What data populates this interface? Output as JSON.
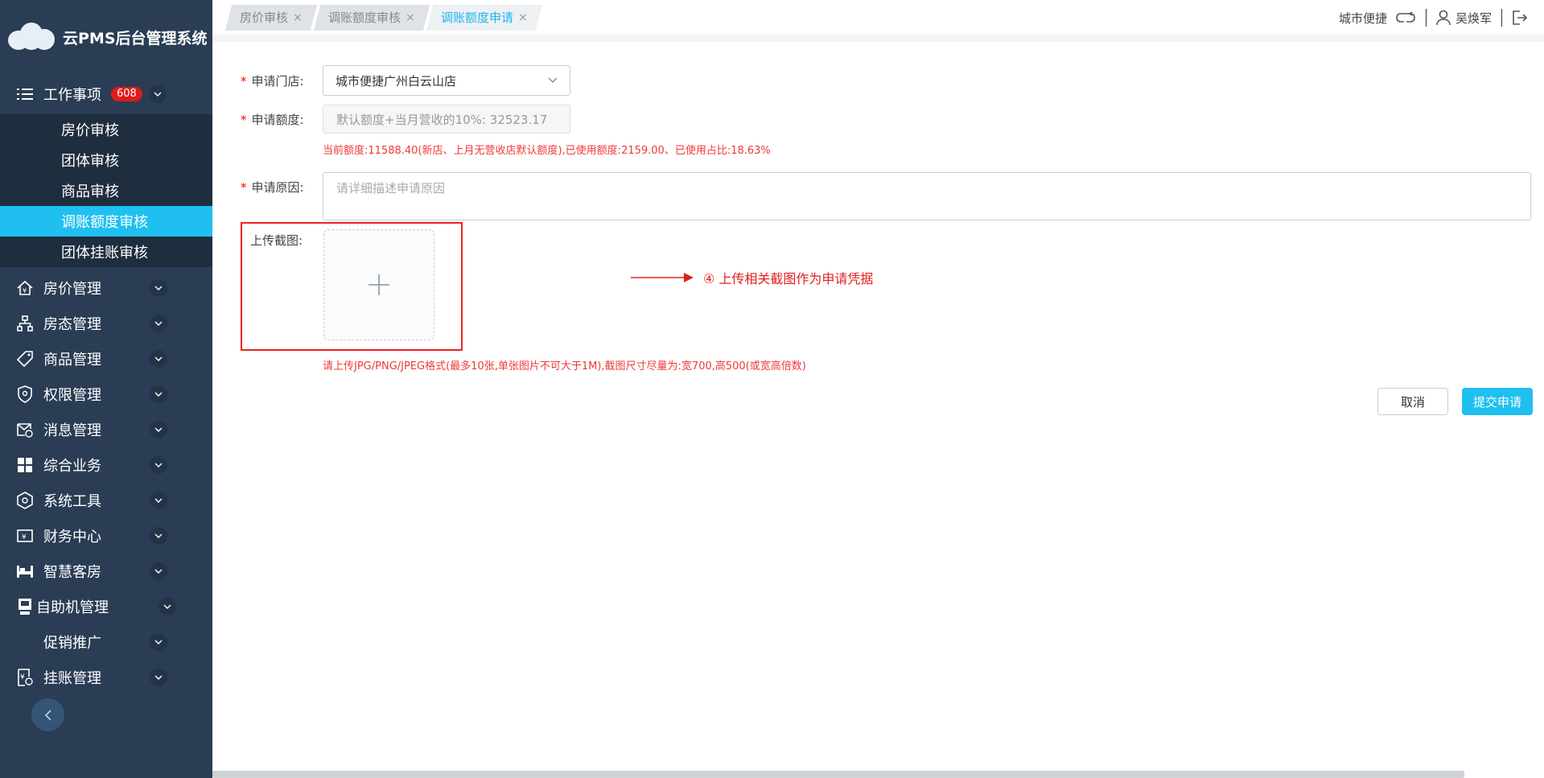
{
  "app": {
    "title": "云PMS后台管理系统"
  },
  "sidebar": {
    "work": {
      "label": "工作事项",
      "badge": "608"
    },
    "work_items": [
      "房价审核",
      "团体审核",
      "商品审核",
      "调账额度审核",
      "团体挂账审核"
    ],
    "active_item": "调账额度审核",
    "menus": [
      {
        "label": "房价管理",
        "icon": "house-price-icon"
      },
      {
        "label": "房态管理",
        "icon": "room-status-icon"
      },
      {
        "label": "商品管理",
        "icon": "tag-icon"
      },
      {
        "label": "权限管理",
        "icon": "shield-icon"
      },
      {
        "label": "消息管理",
        "icon": "message-icon"
      },
      {
        "label": "综合业务",
        "icon": "grid-icon"
      },
      {
        "label": "系统工具",
        "icon": "hexagon-icon"
      },
      {
        "label": "财务中心",
        "icon": "finance-icon"
      },
      {
        "label": "智慧客房",
        "icon": "bed-icon"
      },
      {
        "label": "自助机管理",
        "icon": "kiosk-icon"
      },
      {
        "label": "促销推广",
        "icon": ""
      },
      {
        "label": "挂账管理",
        "icon": "ledger-icon"
      }
    ]
  },
  "tabs": [
    {
      "label": "房价审核",
      "active": false
    },
    {
      "label": "调账额度审核",
      "active": false
    },
    {
      "label": "调账额度申请",
      "active": true
    }
  ],
  "header": {
    "hotel_brand": "城市便捷",
    "user_name": "吴焕军"
  },
  "form": {
    "store": {
      "label": "申请门店:",
      "value": "城市便捷广州白云山店"
    },
    "amount": {
      "label": "申请额度:",
      "placeholder": "默认额度+当月营收的10%:  32523.17"
    },
    "amount_hint": "当前额度:11588.40(新店、上月无营收店默认额度),已使用额度:2159.00、已使用占比:18.63%",
    "reason": {
      "label": "申请原因:",
      "placeholder": "请详细描述申请原因"
    },
    "upload": {
      "label": "上传截图:"
    },
    "upload_hint": "请上传JPG/PNG/JPEG格式(最多10张,单张图片不可大于1M),截图尺寸尽量为:宽700,高500(或宽高倍数)",
    "annotation": "④ 上传相关截图作为申请凭据",
    "cancel": "取消",
    "submit": "提交申请"
  },
  "colors": {
    "sidebar": "#2a3d54",
    "submenu": "#1f2e3f",
    "accent": "#1fc0f0",
    "badge": "#e01b1b",
    "hint": "#f03838"
  }
}
